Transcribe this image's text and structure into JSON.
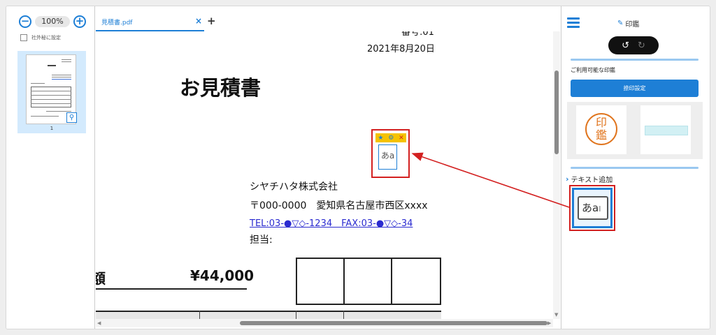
{
  "left": {
    "zoom_minus": "−",
    "zoom_value": "100%",
    "zoom_plus": "+",
    "confidential_label": "社外秘に設定",
    "page_number": "1"
  },
  "tabs": {
    "file_name": "見積書.pdf",
    "close": "×",
    "add": "+"
  },
  "document": {
    "number_partial": "番号:01",
    "date": "2021年8月20日",
    "title": "お見積書",
    "company": "シヤチハタ株式会社",
    "address": "〒000-0000　愛知県名古屋市西区xxxx",
    "tel_fax": "TEL:03-●▽◇-1234　FAX:03-●▽◇-34",
    "person": "担当:",
    "amount_label": "額",
    "amount": "¥44,000",
    "text_box": "あa"
  },
  "right": {
    "panel_title": "印鑑",
    "available_stamps": "ご利用可能な印鑑",
    "stamp_settings_button": "捺印設定",
    "seal_text_line1": "印",
    "seal_text_line2": "鑑",
    "text_add_label": "テキスト追加",
    "text_tool_glyph": "あa"
  },
  "colors": {
    "accent": "#1e7fd6",
    "highlight_red": "#d32020",
    "seal_orange": "#e0751e",
    "toolbar_yellow": "#f5c200"
  }
}
